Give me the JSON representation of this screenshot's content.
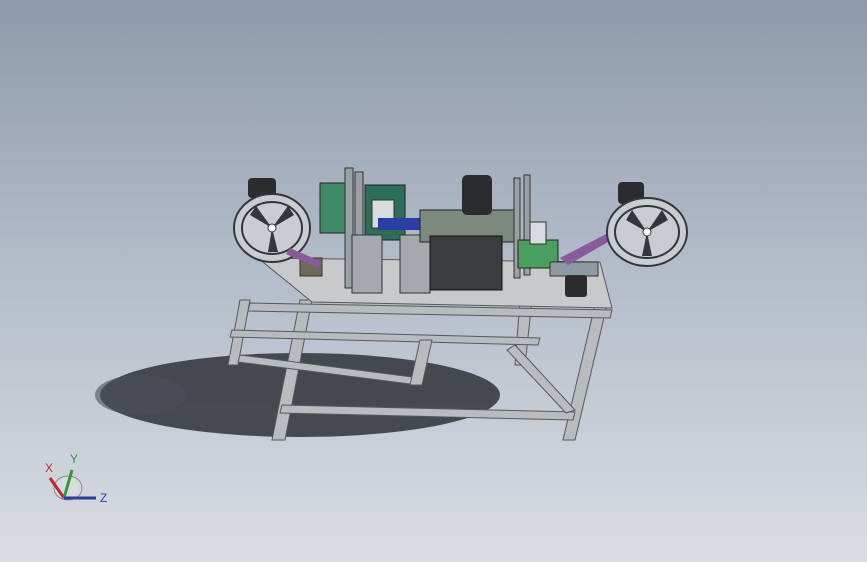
{
  "viewport": {
    "background_top": "#8e9aab",
    "background_bottom": "#d9dde3"
  },
  "model": {
    "frame_color": "#b9bcbf",
    "table_top_color": "#c7c9cb",
    "motor_color": "#2a2c2e",
    "reel_color": "#c9ccd0",
    "accent_green": "#3e8a66",
    "accent_blue": "#2a3ea8",
    "accent_purple": "#8a5a9a"
  },
  "triad": {
    "x_label": "X",
    "y_label": "Y",
    "z_label": "Z",
    "x_color": "#c4262c",
    "y_color": "#2e9a3e",
    "z_color": "#2a3ea8"
  }
}
